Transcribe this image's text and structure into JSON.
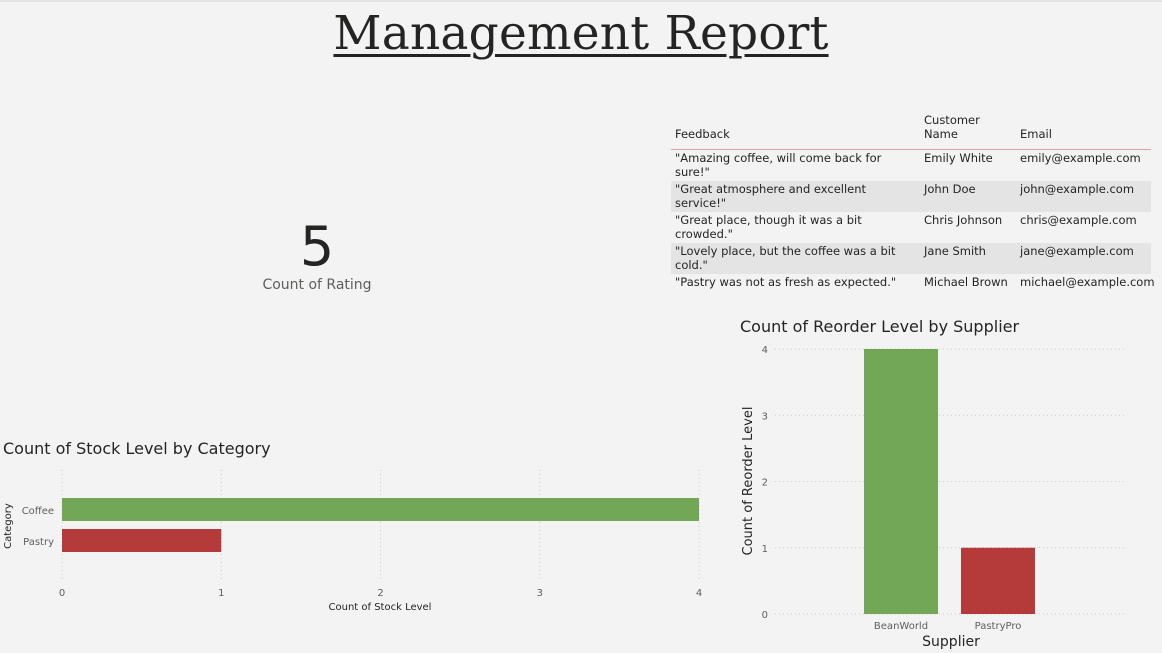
{
  "report": {
    "title": "Management Report"
  },
  "feedback_table": {
    "columns": [
      "Feedback",
      "Customer Name",
      "Email"
    ],
    "rows": [
      [
        "\"Amazing coffee, will come back for sure!\"",
        "Emily White",
        "emily@example.com"
      ],
      [
        "\"Great atmosphere and excellent service!\"",
        "John Doe",
        "john@example.com"
      ],
      [
        "\"Great place, though it was a bit crowded.\"",
        "Chris Johnson",
        "chris@example.com"
      ],
      [
        "\"Lovely place, but the coffee was a bit cold.\"",
        "Jane Smith",
        "jane@example.com"
      ],
      [
        "\"Pastry was not as fresh as expected.\"",
        "Michael Brown",
        "michael@example.com"
      ]
    ]
  },
  "card": {
    "value": "5",
    "label": "Count of Rating"
  },
  "colors": {
    "green": "#72a855",
    "red": "#b53a3a",
    "grid": "#c8c8c8"
  },
  "chart_data": [
    {
      "type": "bar",
      "orientation": "horizontal",
      "title": "Count of Stock Level by Category",
      "xlabel": "Count of Stock Level",
      "ylabel": "Category",
      "categories": [
        "Coffee",
        "Pastry"
      ],
      "values": [
        4,
        1
      ],
      "xlim": [
        0,
        4
      ],
      "ticks": [
        "0",
        "1",
        "2",
        "3",
        "4"
      ],
      "grid": true
    },
    {
      "type": "bar",
      "orientation": "vertical",
      "title": "Count of Reorder Level by Supplier",
      "xlabel": "Supplier",
      "ylabel": "Count of Reorder Level",
      "categories": [
        "BeanWorld",
        "PastryPro"
      ],
      "values": [
        4,
        1
      ],
      "ylim": [
        0,
        4
      ],
      "ticks": [
        "0",
        "1",
        "2",
        "3",
        "4"
      ],
      "grid": true
    }
  ]
}
